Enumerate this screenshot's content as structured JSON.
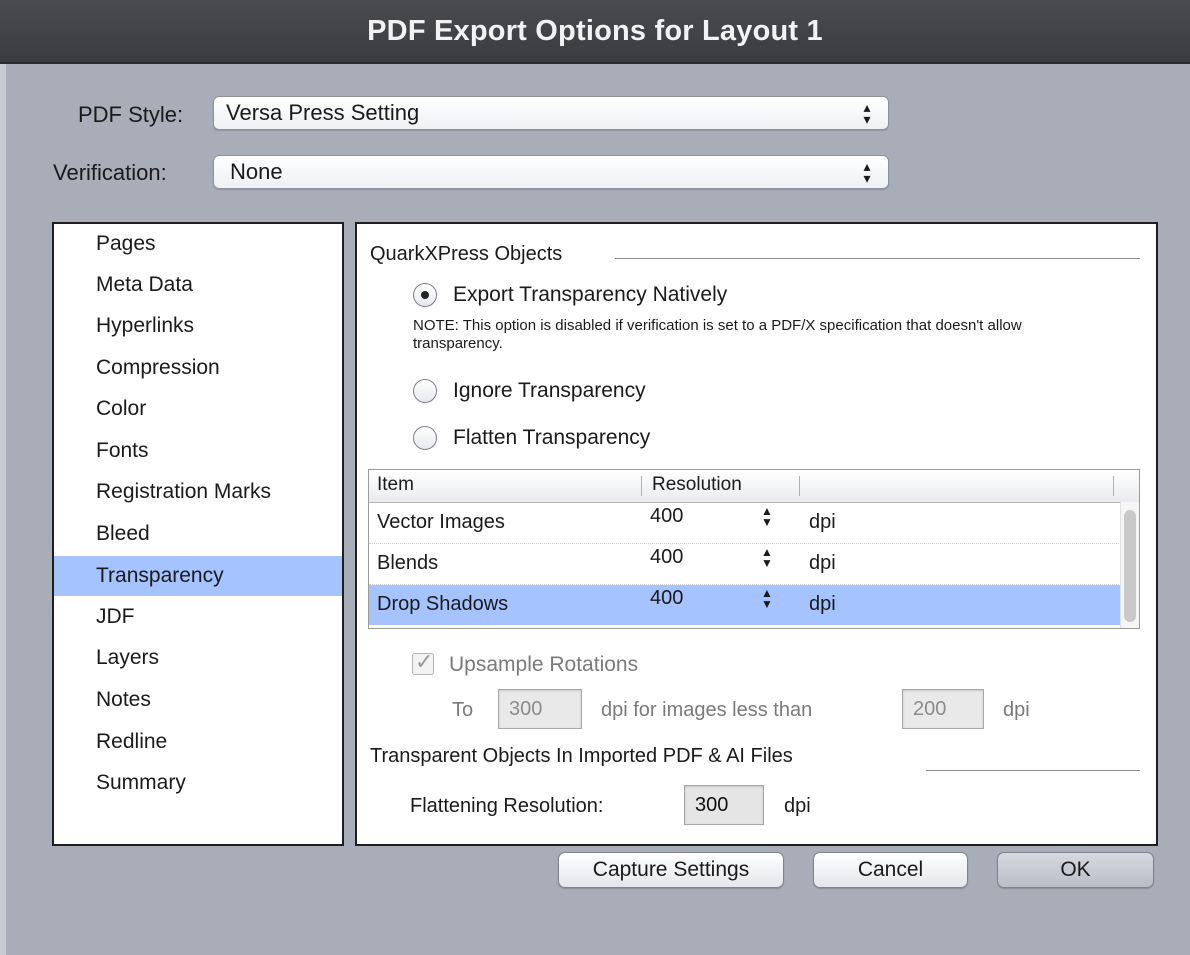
{
  "window": {
    "title": "PDF Export Options for Layout 1"
  },
  "pdf_style": {
    "label": "PDF Style:",
    "value": "Versa Press Setting"
  },
  "verification": {
    "label": "Verification:",
    "value": "None"
  },
  "sidebar": {
    "items": [
      {
        "label": "Pages"
      },
      {
        "label": "Meta Data"
      },
      {
        "label": "Hyperlinks"
      },
      {
        "label": "Compression"
      },
      {
        "label": "Color"
      },
      {
        "label": "Fonts"
      },
      {
        "label": "Registration Marks"
      },
      {
        "label": "Bleed"
      },
      {
        "label": "Transparency"
      },
      {
        "label": "JDF"
      },
      {
        "label": "Layers"
      },
      {
        "label": "Notes"
      },
      {
        "label": "Redline"
      },
      {
        "label": "Summary"
      }
    ],
    "selected": "Transparency"
  },
  "main": {
    "section1_title": "QuarkXPress Objects",
    "radios": {
      "native": "Export Transparency Natively",
      "ignore": "Ignore Transparency",
      "flatten": "Flatten Transparency"
    },
    "note": "NOTE: This option is disabled if verification is set to a PDF/X specification that doesn't allow transparency.",
    "table": {
      "headers": {
        "item": "Item",
        "resolution": "Resolution"
      },
      "rows": [
        {
          "item": "Vector Images",
          "value": "400",
          "unit": "dpi"
        },
        {
          "item": "Blends",
          "value": "400",
          "unit": "dpi"
        },
        {
          "item": "Drop Shadows",
          "value": "400",
          "unit": "dpi"
        }
      ]
    },
    "upsample": {
      "label": "Upsample Rotations",
      "to": "To",
      "to_value": "300",
      "mid": "dpi for images less than",
      "less_value": "200",
      "unit": "dpi"
    },
    "section2_title": "Transparent Objects In Imported PDF & AI Files",
    "flattening": {
      "label": "Flattening Resolution:",
      "value": "300",
      "unit": "dpi"
    }
  },
  "buttons": {
    "capture": "Capture Settings",
    "cancel": "Cancel",
    "ok": "OK"
  }
}
